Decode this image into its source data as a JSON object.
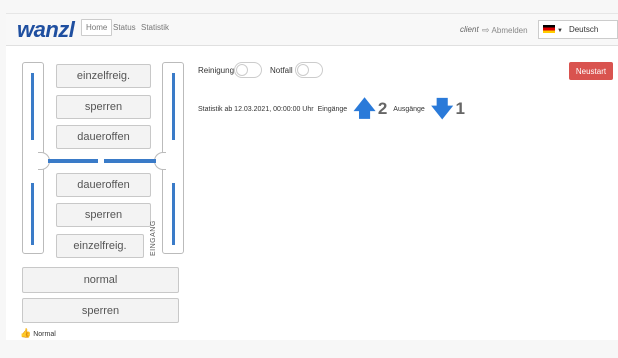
{
  "navbar": {
    "brand": "wanzl",
    "links": [
      "Home",
      "Status",
      "Statistik"
    ],
    "user": "client",
    "logout_label": "Abmelden",
    "language": "Deutsch"
  },
  "gate": {
    "upper_buttons": [
      "einzelfreig.",
      "sperren",
      "daueroffen"
    ],
    "lower_buttons": [
      "daueroffen",
      "sperren",
      "einzelfreig."
    ],
    "side_label": "EINGANG",
    "bottom_buttons": [
      "normal",
      "sperren"
    ],
    "status": "Normal"
  },
  "controls": {
    "cleaning_label": "Reinigung",
    "emergency_label": "Notfall",
    "restart_label": "Neustart"
  },
  "stats": {
    "since": "Statistik ab 12.03.2021, 00:00:00 Uhr",
    "entries_label": "Eingänge",
    "entries": "2",
    "exits_label": "Ausgänge",
    "exits": "1"
  },
  "colors": {
    "brand": "#1f4fa0",
    "accent": "#3a7bc8",
    "danger": "#d9534f",
    "arrow": "#2a7ad9",
    "ok": "#5cb85c"
  }
}
